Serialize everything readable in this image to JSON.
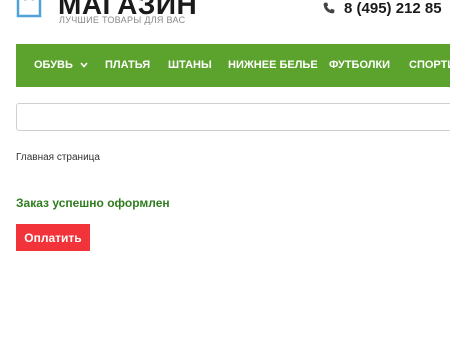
{
  "header": {
    "logo_title": "МАГАЗИН",
    "logo_subtitle": "ЛУЧШИЕ ТОВАРЫ ДЛЯ ВАС",
    "phone": "8 (495) 212 85"
  },
  "nav": {
    "items": [
      {
        "label": "ОБУВЬ",
        "has_dropdown": true
      },
      {
        "label": "ПЛАТЬЯ"
      },
      {
        "label": "ШТАНЫ"
      },
      {
        "label": "НИЖНЕЕ БЕЛЬЕ"
      },
      {
        "label": "ФУТБОЛКИ"
      },
      {
        "label": "СПОРТИ"
      }
    ]
  },
  "search": {
    "value": "",
    "placeholder": ""
  },
  "breadcrumb": {
    "home": "Главная страница"
  },
  "order": {
    "success_message": "Заказ успешно оформлен",
    "pay_button": "Оплатить"
  },
  "colors": {
    "nav_bg": "#5ca32e",
    "success_text": "#2f7d1f",
    "pay_button_bg": "#f2333a",
    "logo_icon": "#4fa3d9"
  }
}
